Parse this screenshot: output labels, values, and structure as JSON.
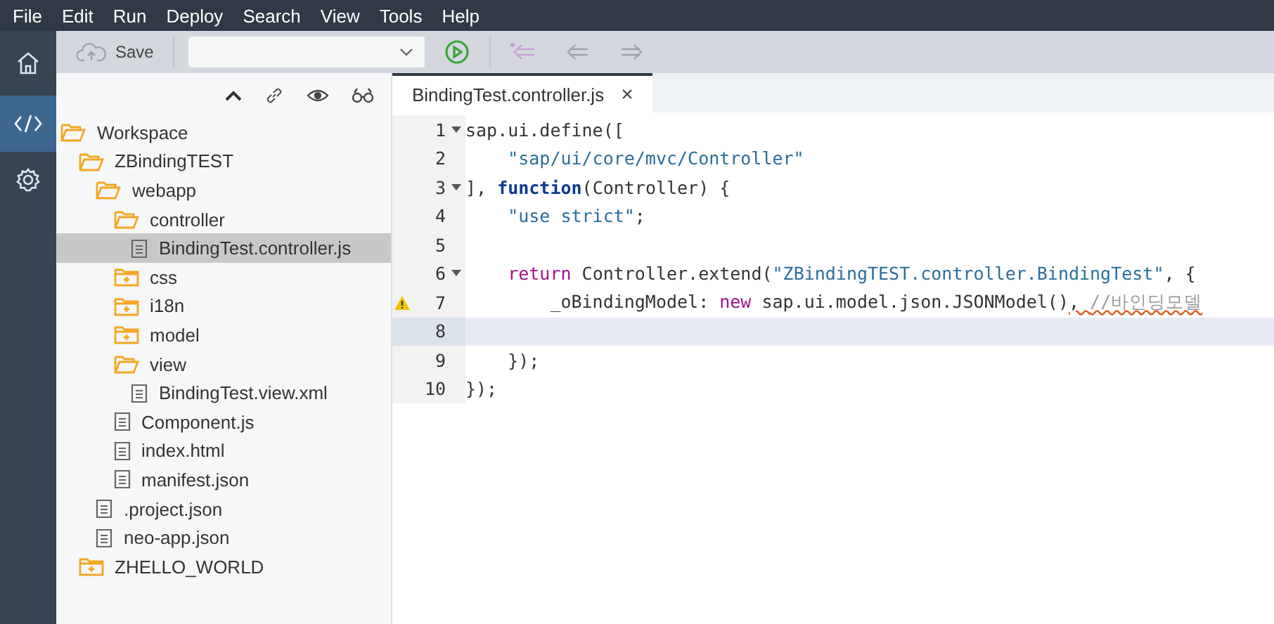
{
  "menu_bar": [
    "File",
    "Edit",
    "Run",
    "Deploy",
    "Search",
    "View",
    "Tools",
    "Help"
  ],
  "side_rail": [
    {
      "kind": "home",
      "selected": false
    },
    {
      "kind": "code",
      "selected": true
    },
    {
      "kind": "settings",
      "selected": false
    }
  ],
  "toolbar": {
    "save_label": "Save"
  },
  "tree": [
    {
      "label": "Workspace",
      "kind": "folder",
      "expanded": true,
      "selected": false,
      "children": [
        {
          "label": "ZBindingTEST",
          "kind": "folder",
          "expanded": true,
          "selected": false,
          "children": [
            {
              "label": "webapp",
              "kind": "folder",
              "expanded": true,
              "selected": false,
              "children": [
                {
                  "label": "controller",
                  "kind": "folder",
                  "expanded": true,
                  "selected": false,
                  "children": [
                    {
                      "label": "BindingTest.controller.js",
                      "kind": "file",
                      "selected": true
                    }
                  ]
                },
                {
                  "label": "css",
                  "kind": "folder",
                  "expanded": false,
                  "selected": false
                },
                {
                  "label": "i18n",
                  "kind": "folder",
                  "expanded": false,
                  "selected": false
                },
                {
                  "label": "model",
                  "kind": "folder",
                  "expanded": false,
                  "selected": false
                },
                {
                  "label": "view",
                  "kind": "folder",
                  "expanded": true,
                  "selected": false,
                  "children": [
                    {
                      "label": "BindingTest.view.xml",
                      "kind": "file",
                      "selected": false
                    }
                  ]
                },
                {
                  "label": "Component.js",
                  "kind": "file",
                  "selected": false
                },
                {
                  "label": "index.html",
                  "kind": "file",
                  "selected": false
                },
                {
                  "label": "manifest.json",
                  "kind": "file",
                  "selected": false
                }
              ]
            },
            {
              "label": ".project.json",
              "kind": "file",
              "selected": false
            },
            {
              "label": "neo-app.json",
              "kind": "file",
              "selected": false
            }
          ]
        },
        {
          "label": "ZHELLO_WORLD",
          "kind": "folder",
          "expanded": false,
          "selected": false
        }
      ]
    }
  ],
  "editor_tabs": [
    {
      "label": "BindingTest.controller.js",
      "close": "×",
      "selected": true
    }
  ],
  "code_lines": [
    {
      "number": "1",
      "fold": true,
      "warning": false,
      "current": false,
      "tokens": [
        {
          "text": "sap.ui.define([",
          "kind": "plain"
        }
      ]
    },
    {
      "number": "2",
      "fold": false,
      "warning": false,
      "current": false,
      "tokens": [
        {
          "text": "    \"sap/ui/core/mvc/Controller\"",
          "kind": "string"
        }
      ]
    },
    {
      "number": "3",
      "fold": true,
      "warning": false,
      "current": false,
      "tokens": [
        {
          "text": "], ",
          "kind": "plain"
        },
        {
          "text": "function",
          "kind": "keyword"
        },
        {
          "text": "(Controller) {",
          "kind": "plain"
        }
      ]
    },
    {
      "number": "4",
      "fold": false,
      "warning": false,
      "current": false,
      "tokens": [
        {
          "text": "    \"use strict\"",
          "kind": "string"
        },
        {
          "text": ";",
          "kind": "plain"
        }
      ]
    },
    {
      "number": "5",
      "fold": false,
      "warning": false,
      "current": false
    },
    {
      "number": "6",
      "fold": true,
      "warning": false,
      "current": false,
      "tokens": [
        {
          "text": "    return",
          "kind": "control"
        },
        {
          "text": " Controller.extend(",
          "kind": "plain"
        },
        {
          "text": "\"ZBindingTEST.controller.BindingTest\"",
          "kind": "string"
        },
        {
          "text": ", {",
          "kind": "plain"
        }
      ]
    },
    {
      "number": "7",
      "fold": false,
      "warning": true,
      "current": false,
      "tokens": [
        {
          "text": "        _oBindingModel: ",
          "kind": "plain"
        },
        {
          "text": "new",
          "kind": "control"
        },
        {
          "text": " sap.ui.model.json.JSONModel()",
          "kind": "plain"
        },
        {
          "text": ", ",
          "kind": "plain",
          "squiggle": true
        },
        {
          "text": "//바인딩모델",
          "kind": "comment",
          "squiggle": true
        }
      ]
    },
    {
      "number": "8",
      "fold": false,
      "warning": false,
      "current": true
    },
    {
      "number": "9",
      "fold": false,
      "warning": false,
      "current": false,
      "tokens": [
        {
          "text": "    });",
          "kind": "plain"
        }
      ]
    },
    {
      "number": "10",
      "fold": false,
      "warning": false,
      "current": false,
      "tokens": [
        {
          "text": "});",
          "kind": "plain"
        }
      ]
    }
  ]
}
